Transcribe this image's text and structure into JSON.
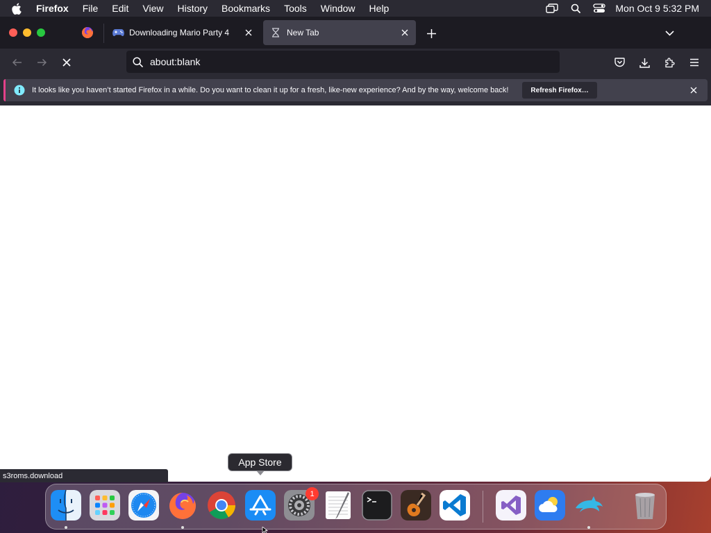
{
  "menubar": {
    "app_name": "Firefox",
    "items": [
      "File",
      "Edit",
      "View",
      "History",
      "Bookmarks",
      "Tools",
      "Window",
      "Help"
    ],
    "clock": "Mon Oct 9  5:32 PM"
  },
  "tabs": [
    {
      "title": "Downloading Mario Party 4",
      "icon": "gamepad-icon",
      "active": false
    },
    {
      "title": "New Tab",
      "icon": "hourglass-icon",
      "active": true
    }
  ],
  "urlbar": {
    "value": "about:blank"
  },
  "notification": {
    "message": "It looks like you haven’t started Firefox in a while. Do you want to clean it up for a fresh, like-new experience? And by the way, welcome back!",
    "button": "Refresh Firefox…"
  },
  "status_text": "s3roms.download",
  "dock": {
    "tooltip": "App Store",
    "apps": [
      "Finder",
      "Launchpad",
      "Safari",
      "Firefox",
      "Google Chrome",
      "App Store",
      "System Settings",
      "TextEdit",
      "Terminal",
      "GarageBand",
      "Visual Studio Code",
      "Visual Studio",
      "Weather",
      "Dolphin",
      "Trash"
    ],
    "settings_badge": "1"
  },
  "colors": {
    "accent_notification": "#e5418a",
    "toolbar": "#2b2a33",
    "tabstrip": "#1c1b22"
  }
}
